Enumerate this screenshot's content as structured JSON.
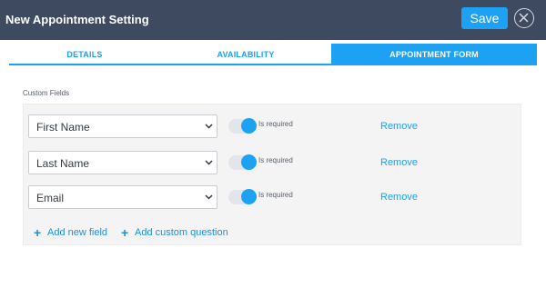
{
  "header": {
    "title": "New Appointment Setting",
    "save_label": "Save"
  },
  "tabs": [
    {
      "label": "DETAILS",
      "active": false
    },
    {
      "label": "AVAILABILITY",
      "active": false
    },
    {
      "label": "APPOINTMENT FORM",
      "active": true
    }
  ],
  "custom_fields": {
    "section_label": "Custom Fields",
    "fields": [
      {
        "value": "First Name",
        "required": true,
        "required_label": "Is required",
        "remove_label": "Remove"
      },
      {
        "value": "Last Name",
        "required": true,
        "required_label": "Is required",
        "remove_label": "Remove"
      },
      {
        "value": "Email",
        "required": true,
        "required_label": "Is required",
        "remove_label": "Remove"
      }
    ],
    "add_field_label": "Add new field",
    "add_question_label": "Add custom question"
  },
  "colors": {
    "header_bg": "#3d4a5f",
    "accent": "#1da1f2",
    "panel_bg": "#f4f4f4"
  }
}
